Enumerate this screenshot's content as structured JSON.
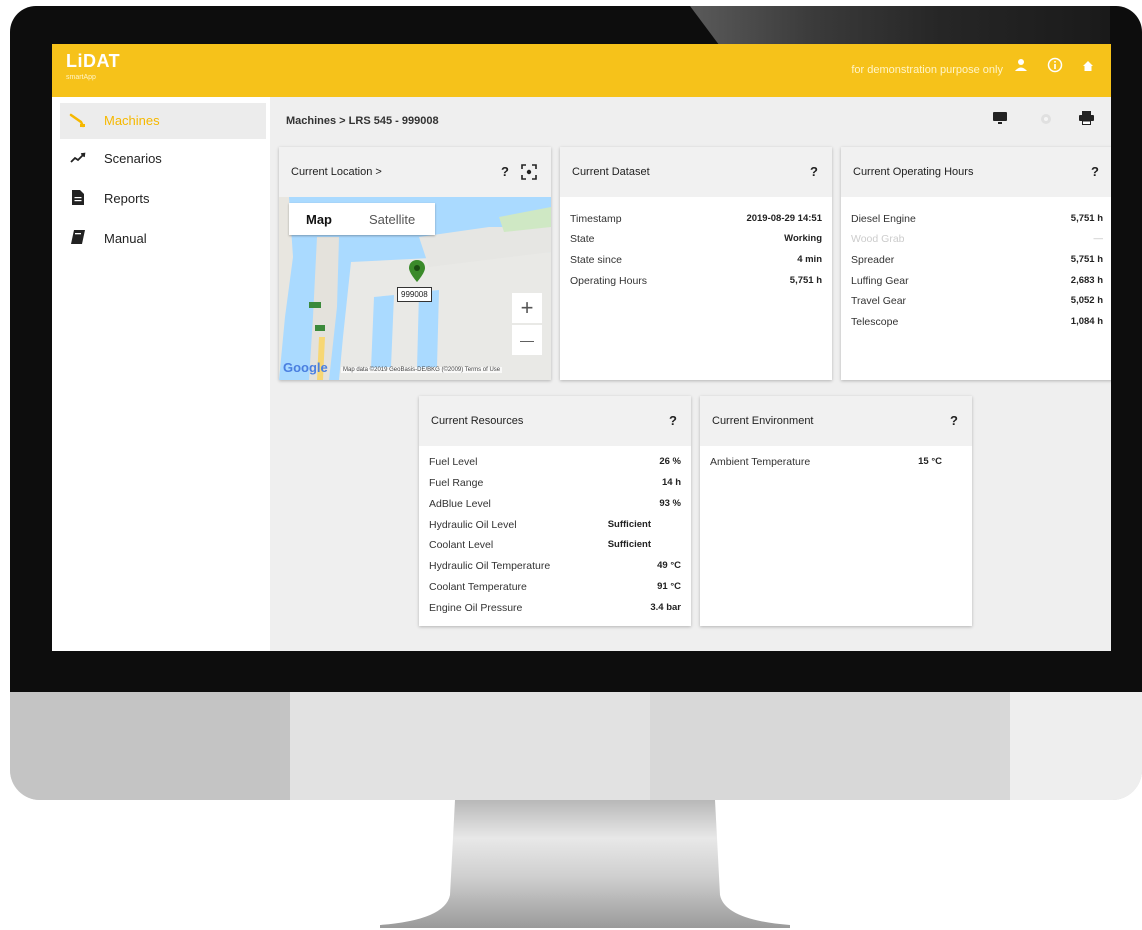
{
  "header": {
    "logo_text": "LiDAT",
    "logo_sub": "smartApp",
    "demo_text": "for demonstration purpose only",
    "icons": [
      "user-icon",
      "info-icon",
      "home-icon"
    ]
  },
  "sidebar": {
    "items": [
      {
        "label": "Machines",
        "icon": "crane-icon",
        "active": true
      },
      {
        "label": "Scenarios",
        "icon": "trend-icon",
        "active": false
      },
      {
        "label": "Reports",
        "icon": "document-icon",
        "active": false
      },
      {
        "label": "Manual",
        "icon": "book-icon",
        "active": false
      }
    ]
  },
  "breadcrumb": {
    "text": "Machines  >  LRS 545 - 999008"
  },
  "location_card": {
    "title": "Current Location  >",
    "help": "?",
    "map_tab": "Map",
    "satellite_tab": "Satellite",
    "marker_label": "999008",
    "zoom_in": "+",
    "zoom_out": "—",
    "google": "Google",
    "attribution": "Map data ©2019 GeoBasis-DE/BKG (©2009)   Terms of Use"
  },
  "dataset_card": {
    "title": "Current Dataset",
    "help": "?",
    "rows": [
      {
        "k": "Timestamp",
        "v": "2019-08-29 14:51"
      },
      {
        "k": "State",
        "v": "Working"
      },
      {
        "k": "State since",
        "v": "4 min"
      },
      {
        "k": "Operating Hours",
        "v": "5,751 h"
      }
    ]
  },
  "hours_card": {
    "title": "Current Operating Hours",
    "help": "?",
    "rows": [
      {
        "k": "Diesel Engine",
        "v": "5,751 h"
      },
      {
        "k": "Wood Grab",
        "v": "—"
      },
      {
        "k": "Spreader",
        "v": "5,751 h"
      },
      {
        "k": "Luffing Gear",
        "v": "2,683 h"
      },
      {
        "k": "Travel Gear",
        "v": "5,052 h"
      },
      {
        "k": "Telescope",
        "v": "1,084 h"
      }
    ]
  },
  "resources_card": {
    "title": "Current Resources",
    "help": "?",
    "rows": [
      {
        "k": "Fuel Level",
        "v": "26 %"
      },
      {
        "k": "Fuel Range",
        "v": "14 h"
      },
      {
        "k": "AdBlue Level",
        "v": "93 %"
      },
      {
        "k": "Hydraulic Oil Level",
        "v": "Sufficient"
      },
      {
        "k": "Coolant Level",
        "v": "Sufficient"
      },
      {
        "k": "Hydraulic Oil Temperature",
        "v": "49 °C"
      },
      {
        "k": "Coolant Temperature",
        "v": "91 °C"
      },
      {
        "k": "Engine Oil Pressure",
        "v": "3.4 bar"
      }
    ]
  },
  "environment_card": {
    "title": "Current Environment",
    "help": "?",
    "rows": [
      {
        "k": "Ambient Temperature",
        "v": "15 °C"
      }
    ]
  }
}
